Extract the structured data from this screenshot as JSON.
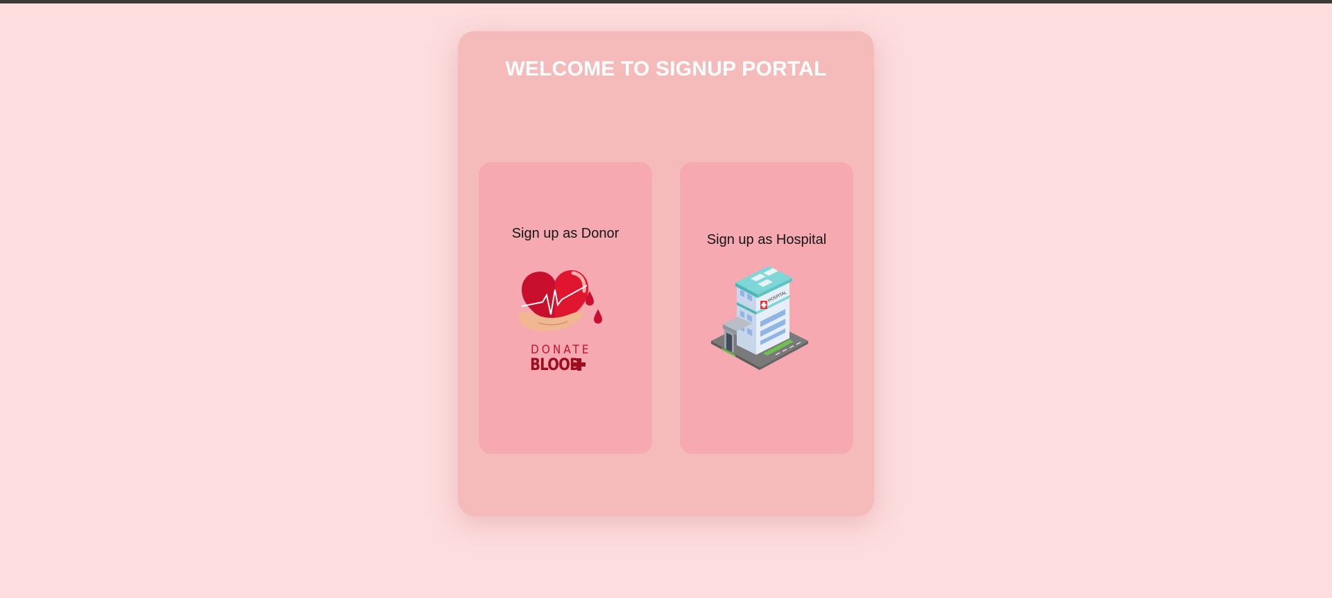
{
  "portal": {
    "title": "WELCOME TO SIGNUP PORTAL"
  },
  "cards": {
    "donor": {
      "label": "Sign up as Donor",
      "image_text_top": "DONATE",
      "image_text_bottom": "BLOOD",
      "icon": "donate-blood-heart-icon"
    },
    "hospital": {
      "label": "Sign up as Hospital",
      "image_sign_text": "HOSPITAL",
      "icon": "hospital-building-icon"
    }
  },
  "colors": {
    "page_background": "#fdddde",
    "portal_background": "#f5bbbb",
    "card_background": "#f6a9b1",
    "title_text": "#ffffff",
    "accent_red": "#c8102e"
  }
}
